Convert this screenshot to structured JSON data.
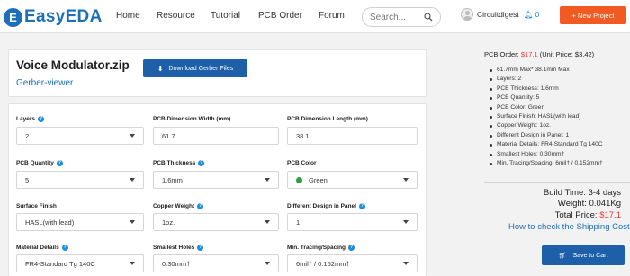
{
  "header": {
    "logo_text": "EasyEDA",
    "nav": [
      "Home",
      "Resource",
      "Tutorial",
      "PCB Order",
      "Forum"
    ],
    "search_placeholder": "Search...",
    "username": "Circuitdigest",
    "notifications": "0",
    "new_project": "+ New Project"
  },
  "project": {
    "title": "Voice Modulator.zip",
    "viewer_link": "Gerber-viewer",
    "download_label": "Download Gerber Files"
  },
  "form": {
    "layers": {
      "label": "Layers",
      "value": "2"
    },
    "dim_width": {
      "label": "PCB Dimension Width (mm)",
      "value": "61.7"
    },
    "dim_length": {
      "label": "PCB Dimension Length (mm)",
      "value": "38.1"
    },
    "quantity": {
      "label": "PCB Quantity",
      "value": "5"
    },
    "thickness": {
      "label": "PCB Thickness",
      "value": "1.6mm"
    },
    "color": {
      "label": "PCB Color",
      "value": "Green",
      "swatch": "#2ea043"
    },
    "surface": {
      "label": "Surface Finish",
      "value": "HASL(with lead)"
    },
    "copper": {
      "label": "Copper Weight",
      "value": "1oz."
    },
    "designs": {
      "label": "Different Design in Panel",
      "value": "1"
    },
    "material": {
      "label": "Material Details",
      "value": "FR4-Standard Tg 140C"
    },
    "holes": {
      "label": "Smallest Holes",
      "value": "0.30mm†"
    },
    "tracing": {
      "label": "Min. Tracing/Spacing",
      "value": "6mil† / 0.152mm†"
    }
  },
  "order": {
    "prefix": "PCB Order:",
    "price": "$17.1",
    "unit": "(Unit Price: $3.42)",
    "specs": [
      "61.7mm Max* 38.1mm Max",
      "Layers: 2",
      "PCB Thickness: 1.6mm",
      "PCB Quantity: 5",
      "PCB Color: Green",
      "Surface Finish: HASL(with lead)",
      "Copper Weight: 1oz.",
      "Different Design in Panel: 1",
      "Material Details: FR4-Standard Tg 140C",
      "Smallest Holes: 0.30mm†",
      "Min. Tracing/Spacing: 6mil† / 0.152mm†"
    ],
    "build_label": "Build Time:",
    "build_value": "3-4 days",
    "weight_label": "Weight:",
    "weight_value": "0.041Kg",
    "total_label": "Total Price:",
    "total_value": "$17.1",
    "shipping_link": "How to check the Shipping Cost",
    "cart_label": "Save to Cart"
  },
  "colors": {
    "brand": "#1d6fb8",
    "accent": "#f15a22",
    "price": "#e53935",
    "button": "#1d5fa8"
  }
}
